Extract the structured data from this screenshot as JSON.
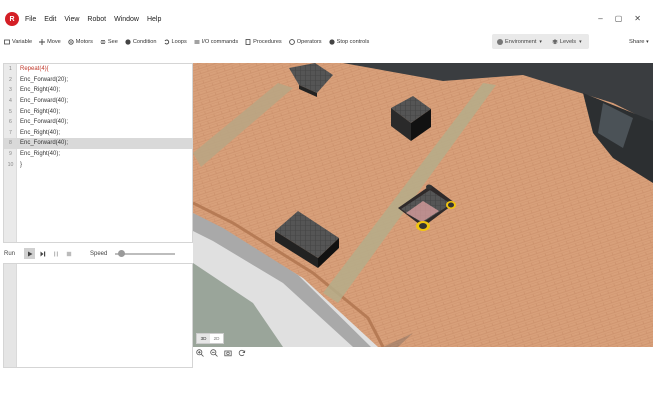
{
  "menu": {
    "logo_letter": "R",
    "items": [
      "File",
      "Edit",
      "View",
      "Robot",
      "Window",
      "Help"
    ]
  },
  "window_controls": [
    "–",
    "▢",
    "✕"
  ],
  "toolbar": {
    "items": [
      "Variable",
      "Move",
      "Motors",
      "See",
      "Condition",
      "Loops",
      "I/O commands",
      "Procedures",
      "Operators",
      "Stop controls"
    ],
    "environment_label": "Environment",
    "levels_label": "Levels",
    "share_label": "Share"
  },
  "code": {
    "lines": [
      {
        "num": "1",
        "text": "Repeat(4){"
      },
      {
        "num": "2",
        "text": "Enc_Forward(20);"
      },
      {
        "num": "3",
        "text": "Enc_Right(40);"
      },
      {
        "num": "4",
        "text": "Enc_Forward(40);"
      },
      {
        "num": "5",
        "text": "Enc_Right(40);"
      },
      {
        "num": "6",
        "text": "Enc_Forward(40);"
      },
      {
        "num": "7",
        "text": "Enc_Right(40);"
      },
      {
        "num": "8",
        "text": "Enc_Forward(40);"
      },
      {
        "num": "9",
        "text": "Enc_Right(40);"
      },
      {
        "num": "10",
        "text": "}"
      }
    ],
    "highlighted_line": 8
  },
  "runbar": {
    "run_label": "Run",
    "speed_label": "Speed",
    "speed_value": 0.05
  },
  "viewport": {
    "view_modes": [
      "3D",
      "2D"
    ],
    "active_mode": "3D"
  },
  "colors": {
    "brand": "#d41f26",
    "floor": "#d79f78",
    "highlight_line": "#d9d9d9"
  }
}
